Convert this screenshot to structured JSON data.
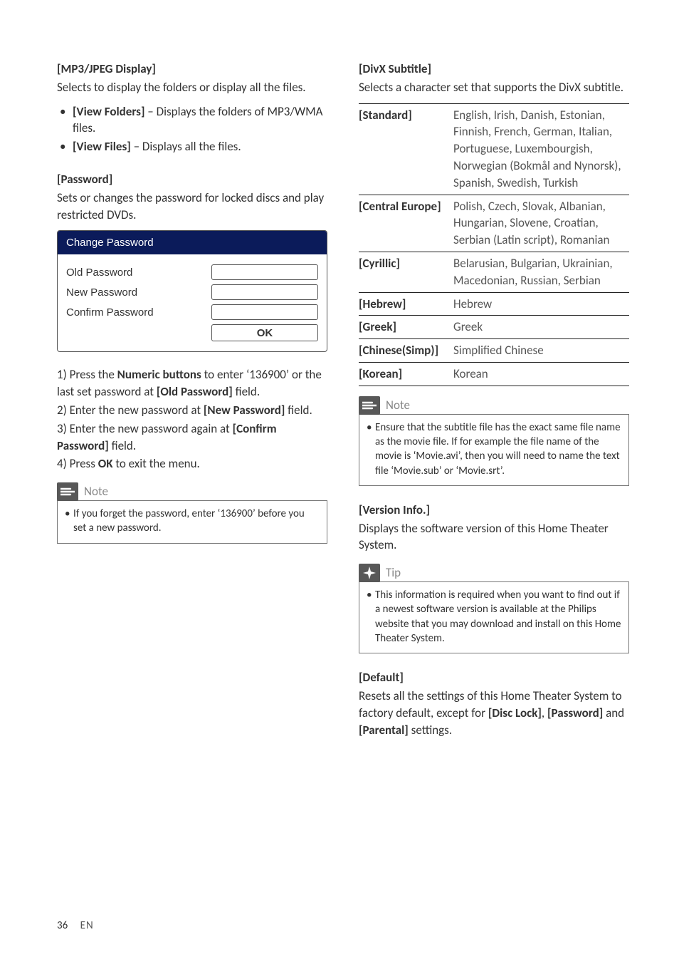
{
  "left": {
    "mp3": {
      "heading": "[MP3/JPEG Display]",
      "desc": "Selects to display the folders or display all the files.",
      "items": [
        {
          "bold": "[View Folders]",
          "rest": " – Displays the folders of MP3/WMA files."
        },
        {
          "bold": "[View Files]",
          "rest": " – Displays all the files."
        }
      ]
    },
    "pw": {
      "heading": "[Password]",
      "desc": "Sets or changes the password for locked discs and play restricted DVDs.",
      "box": {
        "title": "Change Password",
        "rows": [
          "Old Password",
          "New Password",
          "Confirm Password"
        ],
        "ok": "OK"
      },
      "steps": {
        "s1a": "1) Press the ",
        "s1b": "Numeric buttons",
        "s1c": " to enter ‘136900’ or the last set password at ",
        "s1d": "[Old Password]",
        "s1e": " field.",
        "s2a": "2) Enter the new password at ",
        "s2b": "[New Password]",
        "s2c": " field.",
        "s3a": "3) Enter the new password again at ",
        "s3b": "[Confirm Password]",
        "s3c": " field.",
        "s4a": "4) Press ",
        "s4b": "OK",
        "s4c": " to exit the menu."
      },
      "note": {
        "title": "Note",
        "body": "If you forget the password, enter ‘136900’ before you set a new password."
      }
    }
  },
  "right": {
    "divx": {
      "heading": "[DivX Subtitle]",
      "desc": "Selects a character set that supports the DivX subtitle.",
      "rows": [
        {
          "k": "[Standard]",
          "v": "English, Irish, Danish, Estonian, Finnish, French, German, Italian, Portuguese, Luxembourgish, Norwegian (Bokmål and Nynorsk), Spanish, Swedish, Turkish"
        },
        {
          "k": "[Central Europe]",
          "v": "Polish, Czech, Slovak, Albanian, Hungarian, Slovene, Croatian, Serbian (Latin script), Romanian"
        },
        {
          "k": "[Cyrillic]",
          "v": "Belarusian, Bulgarian, Ukrainian, Macedonian, Russian, Serbian"
        },
        {
          "k": "[Hebrew]",
          "v": "Hebrew"
        },
        {
          "k": "[Greek]",
          "v": "Greek"
        },
        {
          "k": "[Chinese(Simp)]",
          "v": "Simplified Chinese"
        },
        {
          "k": "[Korean]",
          "v": "Korean"
        }
      ],
      "note": {
        "title": "Note",
        "body": "Ensure that the subtitle file has the exact same file name as the movie file. If for example the file name of the movie is ‘Movie.avi’, then you will need to name the text file ‘Movie.sub’ or ‘Movie.srt’."
      }
    },
    "ver": {
      "heading": "[Version Info.]",
      "desc": "Displays the software version of this Home Theater System.",
      "tip": {
        "title": "Tip",
        "body": "This information is required when you want to find out if a newest software version is available at the Philips website that you may download and install on this Home Theater System."
      }
    },
    "def": {
      "heading": "[Default]",
      "a": "Resets all the settings of this Home Theater System to factory default, except for ",
      "b": "[Disc Lock]",
      "c": ", ",
      "d": "[Password]",
      "e": " and ",
      "f": "[Parental]",
      "g": " settings."
    }
  },
  "footer": {
    "page": "36",
    "lang": "EN"
  }
}
